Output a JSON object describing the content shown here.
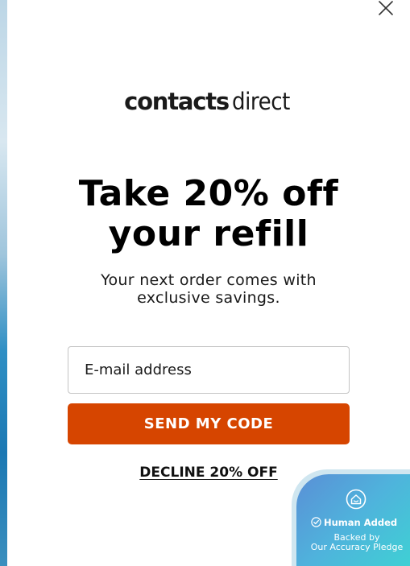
{
  "logo": {
    "bold": "contacts",
    "light": "direct"
  },
  "headline": {
    "line1": "Take 20% off",
    "line2": "your refill"
  },
  "subtext": {
    "line1": "Your next order comes with",
    "line2": "exclusive savings."
  },
  "email": {
    "placeholder": "E-mail address",
    "value": ""
  },
  "submit_label": "SEND MY CODE",
  "decline_label": "DECLINE 20% OFF",
  "badge": {
    "title": "Human Added",
    "line1": "Backed by",
    "line2": "Our Accuracy Pledge",
    "icon": "home-shield-icon"
  },
  "icons": {
    "close": "close-icon",
    "check": "check-circle-icon"
  },
  "colors": {
    "accent": "#d64500",
    "text": "#1a1a1a",
    "badge_gradient_start": "#5a8fd6",
    "badge_gradient_end": "#3fd0d4"
  }
}
